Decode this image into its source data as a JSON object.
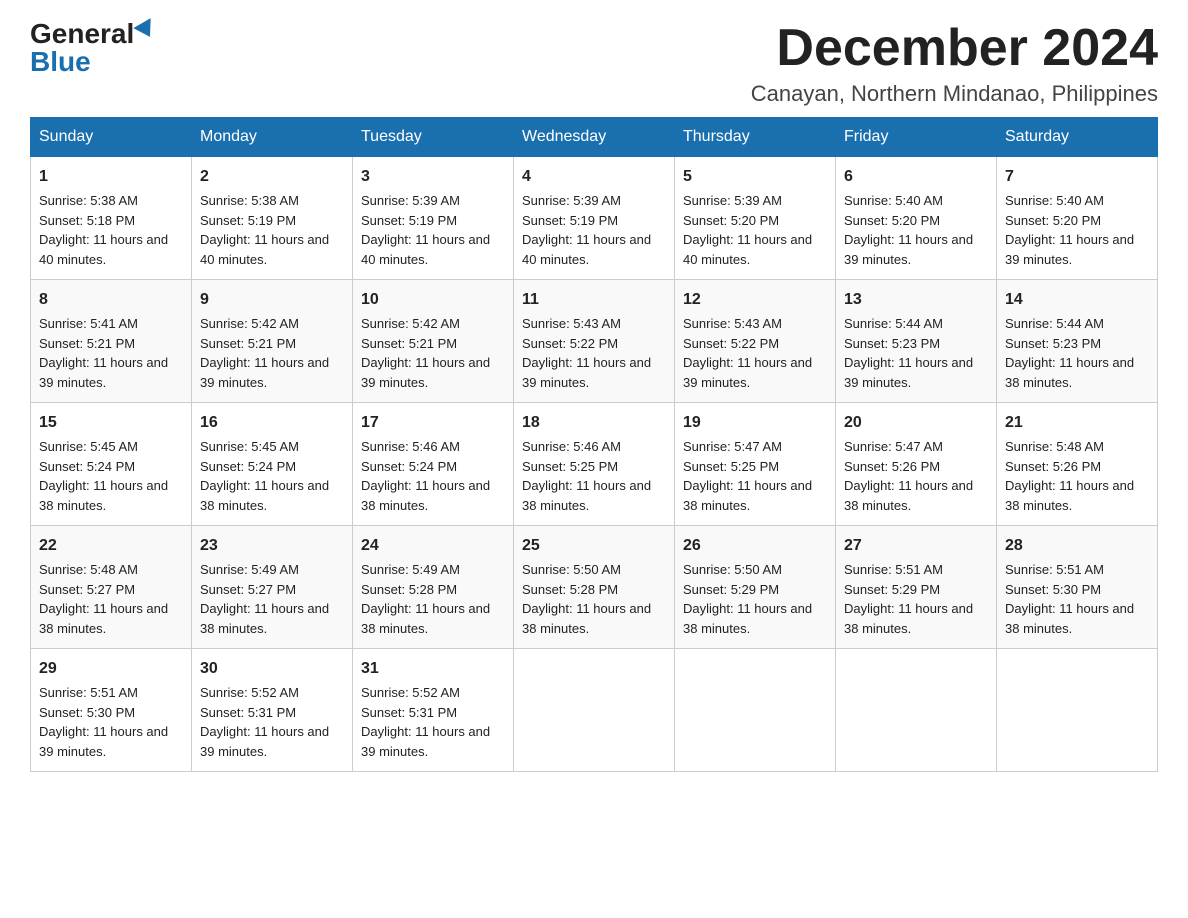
{
  "header": {
    "logo_general": "General",
    "logo_blue": "Blue",
    "month_title": "December 2024",
    "location": "Canayan, Northern Mindanao, Philippines"
  },
  "days_of_week": [
    "Sunday",
    "Monday",
    "Tuesday",
    "Wednesday",
    "Thursday",
    "Friday",
    "Saturday"
  ],
  "weeks": [
    [
      {
        "day": "1",
        "sunrise": "5:38 AM",
        "sunset": "5:18 PM",
        "daylight": "11 hours and 40 minutes."
      },
      {
        "day": "2",
        "sunrise": "5:38 AM",
        "sunset": "5:19 PM",
        "daylight": "11 hours and 40 minutes."
      },
      {
        "day": "3",
        "sunrise": "5:39 AM",
        "sunset": "5:19 PM",
        "daylight": "11 hours and 40 minutes."
      },
      {
        "day": "4",
        "sunrise": "5:39 AM",
        "sunset": "5:19 PM",
        "daylight": "11 hours and 40 minutes."
      },
      {
        "day": "5",
        "sunrise": "5:39 AM",
        "sunset": "5:20 PM",
        "daylight": "11 hours and 40 minutes."
      },
      {
        "day": "6",
        "sunrise": "5:40 AM",
        "sunset": "5:20 PM",
        "daylight": "11 hours and 39 minutes."
      },
      {
        "day": "7",
        "sunrise": "5:40 AM",
        "sunset": "5:20 PM",
        "daylight": "11 hours and 39 minutes."
      }
    ],
    [
      {
        "day": "8",
        "sunrise": "5:41 AM",
        "sunset": "5:21 PM",
        "daylight": "11 hours and 39 minutes."
      },
      {
        "day": "9",
        "sunrise": "5:42 AM",
        "sunset": "5:21 PM",
        "daylight": "11 hours and 39 minutes."
      },
      {
        "day": "10",
        "sunrise": "5:42 AM",
        "sunset": "5:21 PM",
        "daylight": "11 hours and 39 minutes."
      },
      {
        "day": "11",
        "sunrise": "5:43 AM",
        "sunset": "5:22 PM",
        "daylight": "11 hours and 39 minutes."
      },
      {
        "day": "12",
        "sunrise": "5:43 AM",
        "sunset": "5:22 PM",
        "daylight": "11 hours and 39 minutes."
      },
      {
        "day": "13",
        "sunrise": "5:44 AM",
        "sunset": "5:23 PM",
        "daylight": "11 hours and 39 minutes."
      },
      {
        "day": "14",
        "sunrise": "5:44 AM",
        "sunset": "5:23 PM",
        "daylight": "11 hours and 38 minutes."
      }
    ],
    [
      {
        "day": "15",
        "sunrise": "5:45 AM",
        "sunset": "5:24 PM",
        "daylight": "11 hours and 38 minutes."
      },
      {
        "day": "16",
        "sunrise": "5:45 AM",
        "sunset": "5:24 PM",
        "daylight": "11 hours and 38 minutes."
      },
      {
        "day": "17",
        "sunrise": "5:46 AM",
        "sunset": "5:24 PM",
        "daylight": "11 hours and 38 minutes."
      },
      {
        "day": "18",
        "sunrise": "5:46 AM",
        "sunset": "5:25 PM",
        "daylight": "11 hours and 38 minutes."
      },
      {
        "day": "19",
        "sunrise": "5:47 AM",
        "sunset": "5:25 PM",
        "daylight": "11 hours and 38 minutes."
      },
      {
        "day": "20",
        "sunrise": "5:47 AM",
        "sunset": "5:26 PM",
        "daylight": "11 hours and 38 minutes."
      },
      {
        "day": "21",
        "sunrise": "5:48 AM",
        "sunset": "5:26 PM",
        "daylight": "11 hours and 38 minutes."
      }
    ],
    [
      {
        "day": "22",
        "sunrise": "5:48 AM",
        "sunset": "5:27 PM",
        "daylight": "11 hours and 38 minutes."
      },
      {
        "day": "23",
        "sunrise": "5:49 AM",
        "sunset": "5:27 PM",
        "daylight": "11 hours and 38 minutes."
      },
      {
        "day": "24",
        "sunrise": "5:49 AM",
        "sunset": "5:28 PM",
        "daylight": "11 hours and 38 minutes."
      },
      {
        "day": "25",
        "sunrise": "5:50 AM",
        "sunset": "5:28 PM",
        "daylight": "11 hours and 38 minutes."
      },
      {
        "day": "26",
        "sunrise": "5:50 AM",
        "sunset": "5:29 PM",
        "daylight": "11 hours and 38 minutes."
      },
      {
        "day": "27",
        "sunrise": "5:51 AM",
        "sunset": "5:29 PM",
        "daylight": "11 hours and 38 minutes."
      },
      {
        "day": "28",
        "sunrise": "5:51 AM",
        "sunset": "5:30 PM",
        "daylight": "11 hours and 38 minutes."
      }
    ],
    [
      {
        "day": "29",
        "sunrise": "5:51 AM",
        "sunset": "5:30 PM",
        "daylight": "11 hours and 39 minutes."
      },
      {
        "day": "30",
        "sunrise": "5:52 AM",
        "sunset": "5:31 PM",
        "daylight": "11 hours and 39 minutes."
      },
      {
        "day": "31",
        "sunrise": "5:52 AM",
        "sunset": "5:31 PM",
        "daylight": "11 hours and 39 minutes."
      },
      null,
      null,
      null,
      null
    ]
  ]
}
